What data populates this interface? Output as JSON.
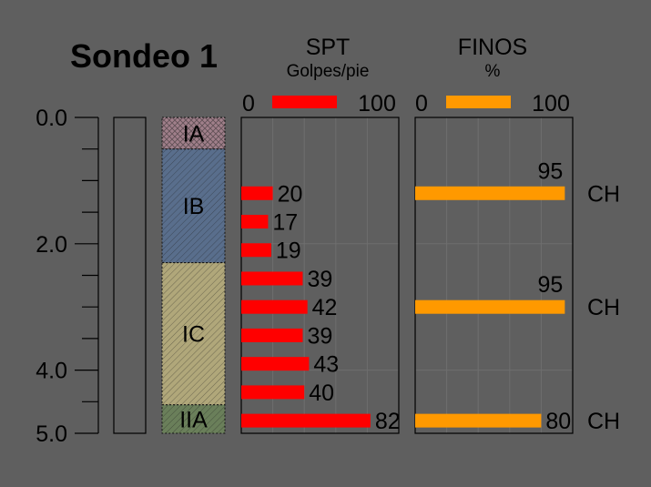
{
  "title": "Sondeo 1",
  "spt_header": {
    "title": "SPT",
    "subtitle": "Golpes/pie",
    "axis_min": "0",
    "axis_max": "100",
    "color": "#ff0000"
  },
  "finos_header": {
    "title": "FINOS",
    "subtitle": "%",
    "axis_min": "0",
    "axis_max": "100",
    "color": "#ff9900"
  },
  "depth_axis": {
    "min": 0.0,
    "max": 5.0,
    "tick_labels": [
      "0.0",
      "2.0",
      "4.0",
      "5.0"
    ],
    "label_values": [
      0,
      2,
      4,
      5
    ]
  },
  "layers": [
    {
      "label": "IA",
      "top": 0.0,
      "bottom": 0.5,
      "color": "#a07f8a"
    },
    {
      "label": "IB",
      "top": 0.5,
      "bottom": 2.3,
      "color": "#596e8c"
    },
    {
      "label": "IC",
      "top": 2.3,
      "bottom": 4.55,
      "color": "#b0a77a"
    },
    {
      "label": "IIA",
      "top": 4.55,
      "bottom": 5.0,
      "color": "#6a7f5a"
    }
  ],
  "chart_data": [
    {
      "type": "bar",
      "title": "SPT",
      "subtitle": "Golpes/pie",
      "xlim": [
        0,
        100
      ],
      "ylim": [
        0,
        5.0
      ],
      "series": [
        {
          "name": "SPT",
          "color": "#ff0000",
          "depths": [
            1.2,
            1.65,
            2.1,
            2.55,
            3.0,
            3.45,
            3.9,
            4.35,
            4.8
          ],
          "values": [
            20,
            17,
            19,
            39,
            42,
            39,
            43,
            40,
            82
          ]
        }
      ]
    },
    {
      "type": "bar",
      "title": "FINOS",
      "subtitle": "%",
      "xlim": [
        0,
        100
      ],
      "ylim": [
        0,
        5.0
      ],
      "series": [
        {
          "name": "FINOS",
          "color": "#ff9900",
          "depths": [
            1.2,
            3.0,
            4.8
          ],
          "values": [
            95,
            95,
            80
          ],
          "classification": [
            "CH",
            "CH",
            "CH"
          ]
        }
      ]
    }
  ]
}
